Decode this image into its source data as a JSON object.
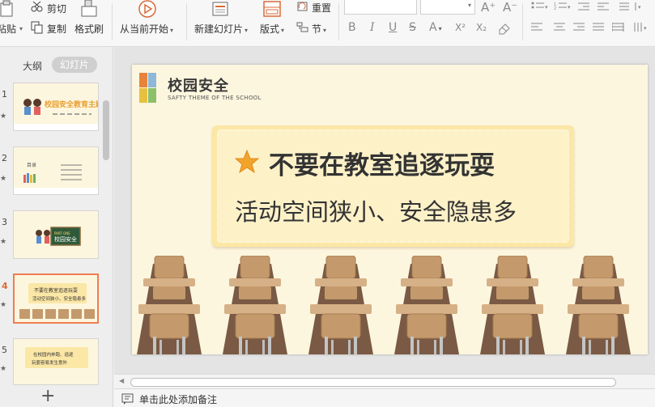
{
  "ribbon": {
    "paste_label": "粘贴",
    "cut_label": "剪切",
    "copy_label": "复制",
    "format_painter_label": "格式刷",
    "play_from_current_label": "从当前开始",
    "new_slide_label": "新建幻灯片",
    "layout_label": "版式",
    "reset_label": "重置",
    "section_label": "节",
    "font_name_value": "",
    "font_size_value": "",
    "grow_font_label": "A⁺",
    "shrink_font_label": "A⁻",
    "bold_label": "B",
    "italic_label": "I",
    "underline_label": "U",
    "strike_label": "S",
    "font_color_label": "A",
    "superscript_label": "X²",
    "subscript_label": "X₂"
  },
  "left_panel": {
    "tab_outline": "大纲",
    "tab_slides": "幻灯片",
    "slides": [
      {
        "number": "1"
      },
      {
        "number": "2"
      },
      {
        "number": "3"
      },
      {
        "number": "4",
        "active": true
      },
      {
        "number": "5"
      }
    ],
    "add_slide_label": "+"
  },
  "slide": {
    "header_title": "校园安全",
    "header_subtitle": "SAFTY THEME OF THE SCHOOL",
    "heading": "不要在教室追逐玩耍",
    "subheading": "活动空间狭小、安全隐患多",
    "desk_count": 6
  },
  "thumbnails": {
    "t1_title": "校园安全教育主题",
    "t2_title": "目录",
    "t3_part": "PART ONE",
    "t3_title": "校园安全",
    "t4_line1": "不要在教室追逐玩耍",
    "t4_line2": "活动空间狭小、安全隐患多",
    "t5_line1": "在校园内奔跑、追逐",
    "t5_line2": "玩耍容易发生意外"
  },
  "notes": {
    "placeholder": "单击此处添加备注"
  },
  "colors": {
    "accent": "#f07d52",
    "slide_bg": "#fdf6df",
    "panel_bg": "#fbe7a6",
    "desk_wood": "#c49a6c",
    "desk_dark": "#7a5a44"
  }
}
